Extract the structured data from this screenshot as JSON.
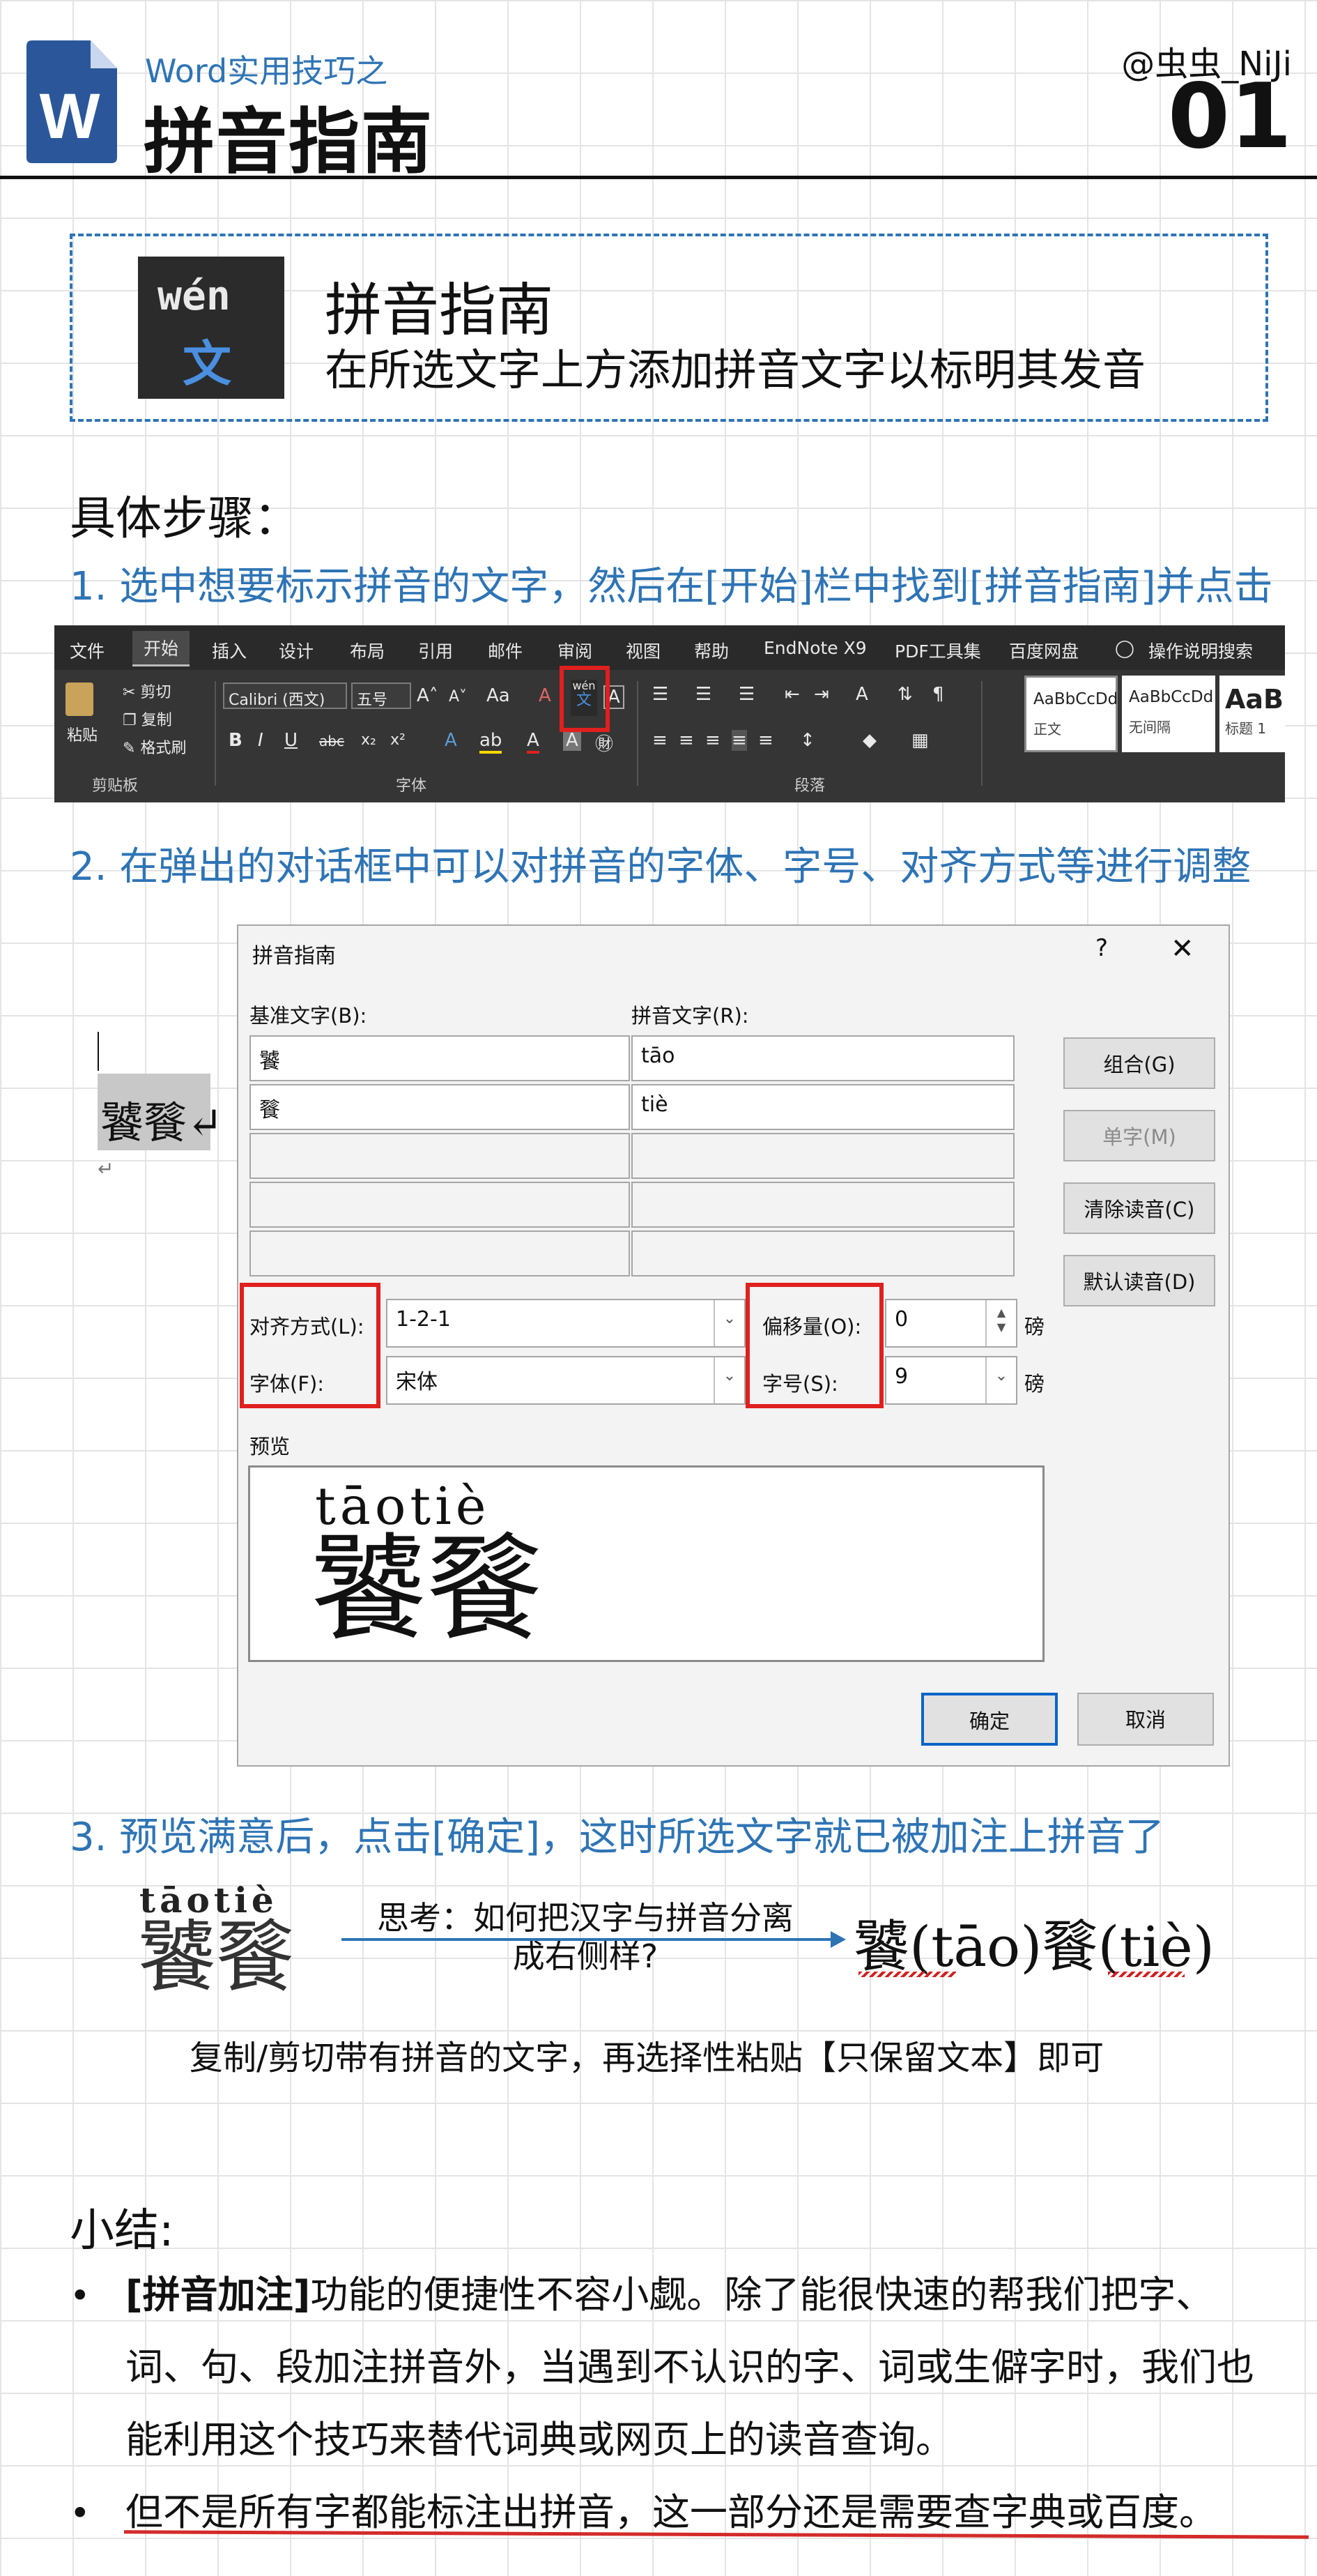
{
  "header": {
    "subtitle": "Word实用技巧之",
    "title": "拼音指南",
    "author": "@虫虫_NiJi",
    "issue": "01",
    "logo_letter": "W",
    "logo_color": "#2b579a"
  },
  "intro": {
    "icon_top": "wén",
    "icon_bottom": "文",
    "title": "拼音指南",
    "description": "在所选文字上方添加拼音文字以标明其发音"
  },
  "steps": {
    "heading": "具体步骤：",
    "step1": "1. 选中想要标示拼音的文字，然后在[开始]栏中找到[拼音指南]并点击",
    "step2": "2. 在弹出的对话框中可以对拼音的字体、字号、对齐方式等进行调整",
    "step3": "3. 预览满意后，点击[确定]，这时所选文字就已被加注上拼音了"
  },
  "ribbon": {
    "tabs": [
      "文件",
      "开始",
      "插入",
      "设计",
      "布局",
      "引用",
      "邮件",
      "审阅",
      "视图",
      "帮助",
      "EndNote X9",
      "PDF工具集",
      "百度网盘",
      "操作说明搜索"
    ],
    "active_tab": "开始",
    "clipboard": {
      "paste": "粘贴",
      "cut": "剪切",
      "copy": "复制",
      "format_painter": "格式刷",
      "group": "剪贴板"
    },
    "font": {
      "name": "Calibri (西文)",
      "size": "五号",
      "group": "字体",
      "pinyin_icon_top": "wén",
      "pinyin_icon_bottom": "文"
    },
    "paragraph": {
      "group": "段落"
    },
    "styles": [
      {
        "preview": "AaBbCcDd",
        "name": "正文"
      },
      {
        "preview": "AaBbCcDd",
        "name": "无间隔"
      },
      {
        "preview": "AaBb",
        "name": "标题 1"
      }
    ]
  },
  "dialog": {
    "title": "拼音指南",
    "help": "?",
    "close": "✕",
    "base_text_label": "基准文字(B):",
    "ruby_text_label": "拼音文字(R):",
    "rows": [
      {
        "base": "饕",
        "ruby": "tāo"
      },
      {
        "base": "餮",
        "ruby": "tiè"
      },
      {
        "base": "",
        "ruby": ""
      },
      {
        "base": "",
        "ruby": ""
      },
      {
        "base": "",
        "ruby": ""
      }
    ],
    "buttons": {
      "group": "组合(G)",
      "mono": "单字(M)",
      "clear": "清除读音(C)",
      "default": "默认读音(D)",
      "ok": "确定",
      "cancel": "取消"
    },
    "alignment_label": "对齐方式(L):",
    "alignment_value": "1-2-1",
    "font_label": "字体(F):",
    "font_value": "宋体",
    "offset_label": "偏移量(O):",
    "offset_value": "0",
    "size_label": "字号(S):",
    "size_value": "9",
    "unit": "磅",
    "preview_label": "预览",
    "preview_pinyin": "tāotiè",
    "preview_hanzi": "饕餮",
    "doc_chars": "饕餮↵",
    "doc_para_mark": "↵"
  },
  "example": {
    "pinyin": "tāotiè",
    "hanzi": "饕餮",
    "think_line1": "思考：如何把汉字与拼音分离",
    "think_line2": "成右侧样?",
    "result": "饕(tāo)餮(tiè)",
    "tip": "复制/剪切带有拼音的文字，再选择性粘贴【只保留文本】即可"
  },
  "summary": {
    "heading": "小结:",
    "bullet1_bold": "[拼音加注]",
    "bullet1_rest": "功能的便捷性不容小觑。除了能很快速的帮我们把字、词、句、段加注拼音外，当遇到不认识的字、词或生僻字时，我们也能利用这个技巧来替代词典或网页上的读音查询。",
    "bullet2": "但不是所有字都能标注出拼音，这一部分还是需要查字典或百度。",
    "bullet_symbol": "•"
  },
  "colors": {
    "accent_blue": "#2e74b5",
    "highlight_red": "#e0201e",
    "ribbon_dark": "#353535"
  }
}
